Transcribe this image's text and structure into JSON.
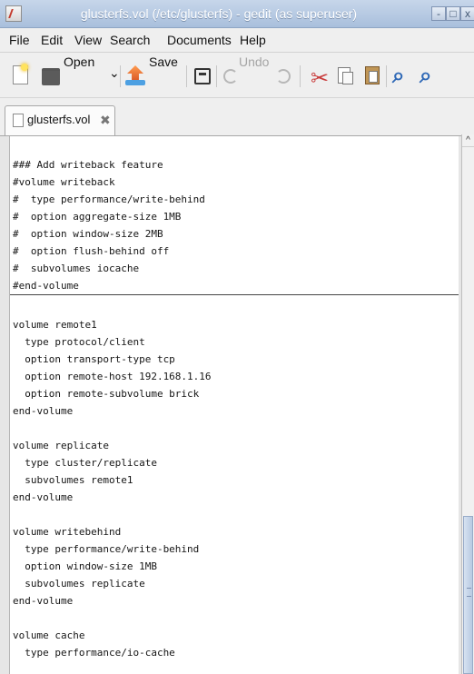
{
  "window": {
    "title": "glusterfs.vol (/etc/glusterfs) - gedit (as superuser)",
    "controls": {
      "minimize": "-",
      "maximize": "□",
      "close": "x"
    }
  },
  "menu": [
    {
      "label": "File"
    },
    {
      "label": "Edit"
    },
    {
      "label": "View"
    },
    {
      "label": "Search"
    },
    {
      "label": "Documents"
    },
    {
      "label": "Help"
    }
  ],
  "toolbar": {
    "open": "Open",
    "open_arrow": "⌄",
    "save": "Save",
    "undo": "Undo",
    "icons": {
      "new": "new-document-icon",
      "open": "folder-open-icon",
      "save": "save-icon",
      "print": "print-icon",
      "undo": "undo-icon",
      "redo": "redo-icon",
      "cut": "cut-icon",
      "copy": "copy-icon",
      "paste": "paste-icon",
      "find": "find-icon",
      "replace": "find-replace-icon"
    }
  },
  "tab": {
    "label": "glusterfs.vol",
    "close": "✖"
  },
  "editor": {
    "lines": [
      "",
      "### Add writeback feature",
      "#volume writeback",
      "#  type performance/write-behind",
      "#  option aggregate-size 1MB",
      "#  option window-size 2MB",
      "#  option flush-behind off",
      "#  subvolumes iocache",
      "#end-volume",
      "",
      "volume remote1",
      "  type protocol/client",
      "  option transport-type tcp",
      "  option remote-host 192.168.1.16",
      "  option remote-subvolume brick",
      "end-volume",
      "",
      "volume replicate",
      "  type cluster/replicate",
      "  subvolumes remote1",
      "end-volume",
      "",
      "volume writebehind",
      "  type performance/write-behind",
      "  option window-size 1MB",
      "  subvolumes replicate",
      "end-volume",
      "",
      "volume cache",
      "  type performance/io-cache"
    ]
  },
  "scrollbar": {
    "up_arrow": "^"
  },
  "colors": {
    "title_bar": "#a9bfdc",
    "window_bg": "#efefef",
    "editor_bg": "#ffffff",
    "scroll_thumb": "#b8cae2"
  }
}
